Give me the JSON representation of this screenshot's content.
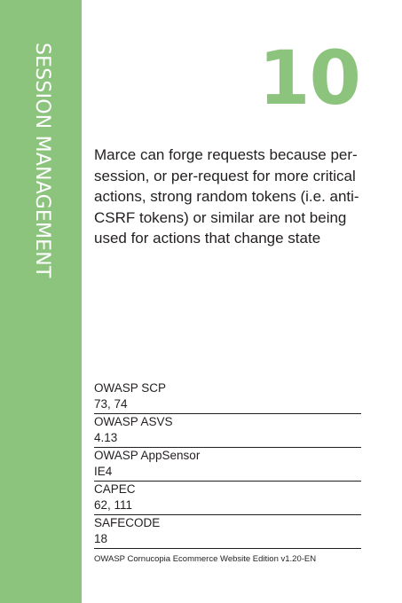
{
  "card": {
    "suit": "SESSION MANAGEMENT",
    "number": "10",
    "description": "Marce can forge requests because per-session, or per-request for more critical actions, strong random tokens (i.e. anti-CSRF tokens) or similar are not being used for actions that change state",
    "references": [
      {
        "name": "OWASP SCP",
        "value": "73, 74"
      },
      {
        "name": "OWASP ASVS",
        "value": "4.13"
      },
      {
        "name": "OWASP AppSensor",
        "value": "IE4"
      },
      {
        "name": "CAPEC",
        "value": "62, 111"
      },
      {
        "name": "SAFECODE",
        "value": "18"
      }
    ],
    "footer": "OWASP Cornucopia Ecommerce Website Edition v1.20-EN"
  },
  "colors": {
    "accent": "#8cc47e",
    "text": "#231f20",
    "background": "#ffffff"
  }
}
